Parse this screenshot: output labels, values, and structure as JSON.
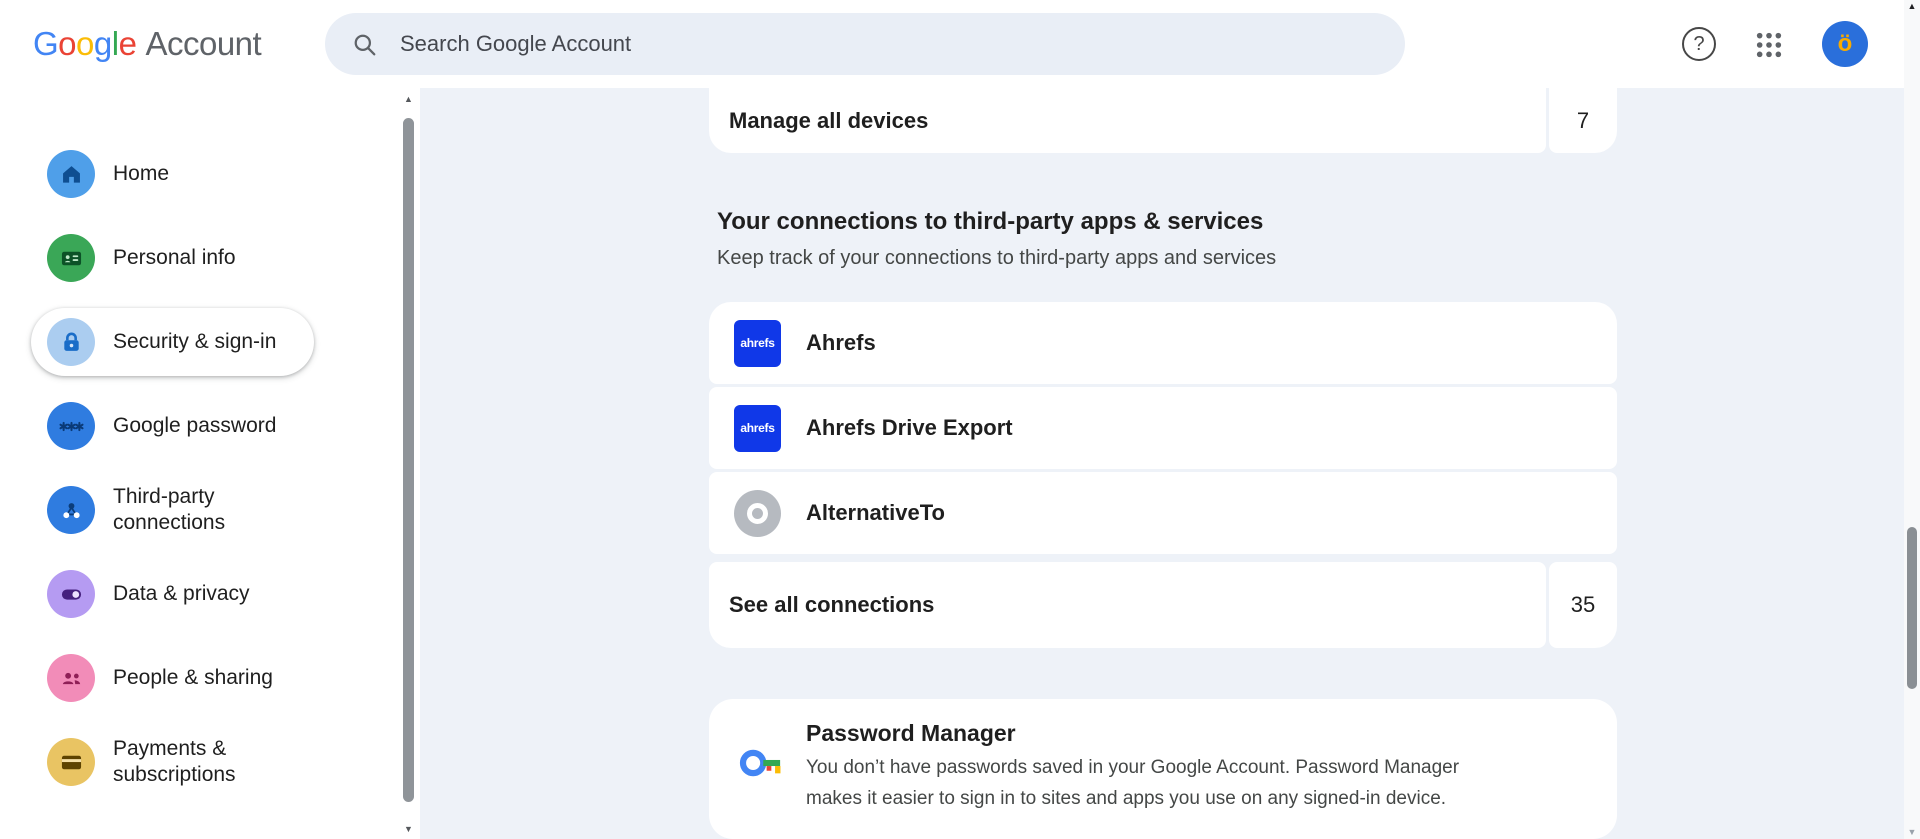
{
  "header": {
    "logo_google": "Google",
    "logo_colors": [
      "#4285F4",
      "#EA4335",
      "#FBBC05",
      "#4285F4",
      "#34A853",
      "#EA4335"
    ],
    "logo_account": "Account",
    "search_placeholder": "Search Google Account",
    "help_glyph": "?",
    "avatar_letter": "ö"
  },
  "sidebar": {
    "items": [
      {
        "label": "Home"
      },
      {
        "label": "Personal info"
      },
      {
        "label": "Security & sign-in",
        "selected": true
      },
      {
        "label": "Google password"
      },
      {
        "label": "Third-party connections"
      },
      {
        "label": "Data & privacy"
      },
      {
        "label": "People & sharing"
      },
      {
        "label": "Payments & subscriptions"
      }
    ]
  },
  "main": {
    "manage_devices": {
      "label": "Manage all devices",
      "count": "7"
    },
    "connections": {
      "heading": "Your connections to third-party apps & services",
      "subheading": "Keep track of your connections to third-party apps and services",
      "apps": [
        {
          "name": "Ahrefs",
          "icon_text": "ahrefs"
        },
        {
          "name": "Ahrefs Drive Export",
          "icon_text": "ahrefs"
        },
        {
          "name": "AlternativeTo"
        }
      ],
      "see_all_label": "See all connections",
      "see_all_count": "35"
    },
    "password_manager": {
      "title": "Password Manager",
      "description": "You don’t have passwords saved in your Google Account. Password Manager makes it easier to sign in to sites and apps you use on any signed-in device.",
      "description_lines": [
        "You don’t have passwords saved in your Google Account. Password Manager",
        "makes it easier to sign in to sites and apps you use on any signed-in device."
      ]
    }
  },
  "icons": {
    "search": "magnifier",
    "help": "question-mark-circle",
    "apps": "3x3-dot-grid",
    "home": "house",
    "personal_info": "id-card",
    "security": "padlock",
    "google_password": "asterisks",
    "third_party_connections": "connected-nodes",
    "data_privacy": "toggle-switch",
    "people_sharing": "two-people",
    "payments": "credit-card",
    "password_manager": "google-colored-key",
    "alternativeto": "gray-circle-white-ring",
    "scroll_up": "▲",
    "scroll_down": "▼"
  },
  "colors": {
    "page_bg": "#eef2f8",
    "search_bg": "#e9eef6",
    "text_primary": "#1f1f1f",
    "text_secondary": "#444746",
    "ahrefs_blue": "#1038e8",
    "avatar_bg": "#2a6fdb",
    "avatar_letter": "#f9ab00"
  }
}
